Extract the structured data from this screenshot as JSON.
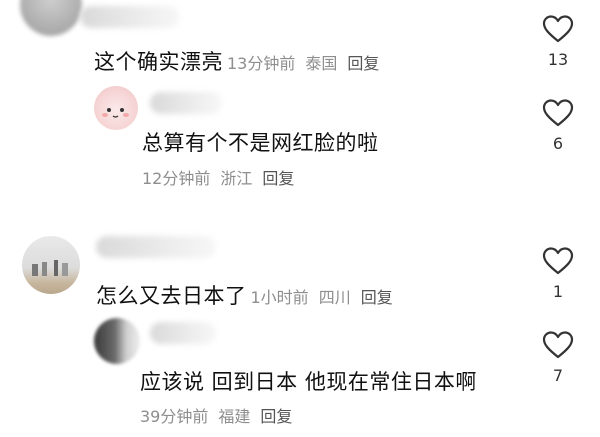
{
  "comments": [
    {
      "text": "这个确实漂亮",
      "time": "13分钟前",
      "location": "泰国",
      "reply_label": "回复",
      "likes": "13"
    },
    {
      "text": "总算有个不是网红脸的啦",
      "time": "12分钟前",
      "location": "浙江",
      "reply_label": "回复",
      "likes": "6"
    },
    {
      "text": "怎么又去日本了",
      "time": "1小时前",
      "location": "四川",
      "reply_label": "回复",
      "likes": "1"
    },
    {
      "text": "应该说 回到日本 他现在常住日本啊",
      "time": "39分钟前",
      "location": "福建",
      "reply_label": "回复",
      "likes": "7"
    }
  ],
  "colors": {
    "meta_text": "#8e8e8e",
    "body_text": "#111111",
    "heart_stroke": "#333333"
  }
}
